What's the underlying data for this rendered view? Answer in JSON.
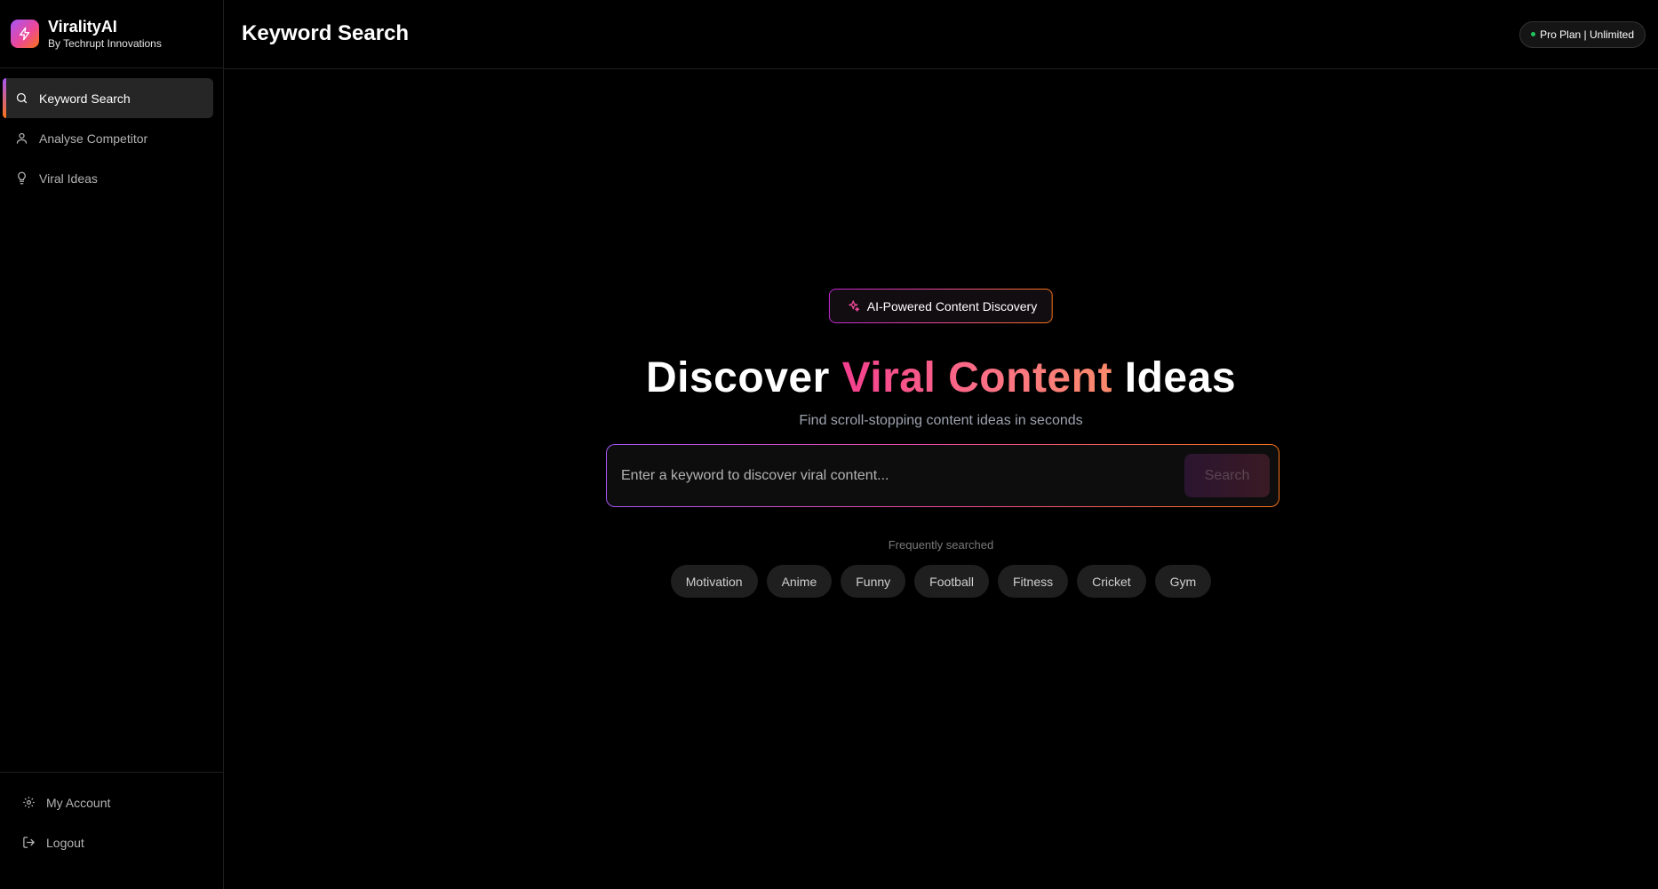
{
  "brand": {
    "name": "ViralityAI",
    "subtitle": "By Techrupt Innovations",
    "logo_icon": "lightning-bolt-icon",
    "gradient": [
      "#a855f7",
      "#ec4899",
      "#f97316"
    ]
  },
  "sidebar": {
    "items": [
      {
        "label": "Keyword Search",
        "icon": "search-icon",
        "active": true
      },
      {
        "label": "Analyse Competitor",
        "icon": "user-icon",
        "active": false
      },
      {
        "label": "Viral Ideas",
        "icon": "lightbulb-icon",
        "active": false
      }
    ],
    "bottom": [
      {
        "label": "My Account",
        "icon": "gear-icon"
      },
      {
        "label": "Logout",
        "icon": "logout-icon"
      }
    ]
  },
  "header": {
    "title": "Keyword Search",
    "plan_badge": "Pro Plan | Unlimited",
    "plan_status_color": "#22c55e"
  },
  "main": {
    "pill_label": "AI-Powered Content Discovery",
    "pill_icon": "sparkles-icon",
    "hero": {
      "part1": "Discover ",
      "highlight": "Viral Content",
      "part2": " Ideas"
    },
    "subtitle": "Find scroll-stopping content ideas in seconds",
    "search": {
      "placeholder": "Enter a keyword to discover viral content...",
      "value": "",
      "button_label": "Search"
    },
    "frequently_label": "Frequently searched",
    "tags": [
      "Motivation",
      "Anime",
      "Funny",
      "Football",
      "Fitness",
      "Cricket",
      "Gym"
    ]
  }
}
